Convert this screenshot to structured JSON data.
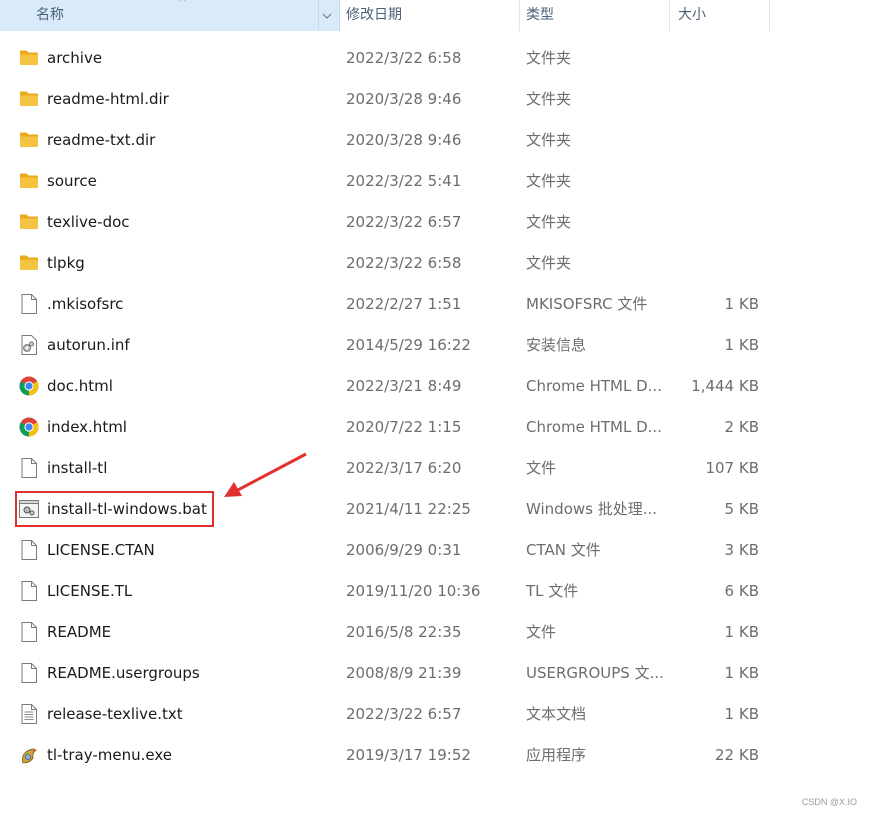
{
  "columns": {
    "name": "名称",
    "date": "修改日期",
    "type": "类型",
    "size": "大小"
  },
  "files": [
    {
      "name": "archive",
      "date": "2022/3/22 6:58",
      "type": "文件夹",
      "size": "",
      "icon": "folder-icon"
    },
    {
      "name": "readme-html.dir",
      "date": "2020/3/28 9:46",
      "type": "文件夹",
      "size": "",
      "icon": "folder-icon"
    },
    {
      "name": "readme-txt.dir",
      "date": "2020/3/28 9:46",
      "type": "文件夹",
      "size": "",
      "icon": "folder-icon"
    },
    {
      "name": "source",
      "date": "2022/3/22 5:41",
      "type": "文件夹",
      "size": "",
      "icon": "folder-icon"
    },
    {
      "name": "texlive-doc",
      "date": "2022/3/22 6:57",
      "type": "文件夹",
      "size": "",
      "icon": "folder-icon"
    },
    {
      "name": "tlpkg",
      "date": "2022/3/22 6:58",
      "type": "文件夹",
      "size": "",
      "icon": "folder-icon"
    },
    {
      "name": ".mkisofsrc",
      "date": "2022/2/27 1:51",
      "type": "MKISOFSRC 文件",
      "size": "1 KB",
      "icon": "blank-file-icon"
    },
    {
      "name": "autorun.inf",
      "date": "2014/5/29 16:22",
      "type": "安装信息",
      "size": "1 KB",
      "icon": "settings-file-icon"
    },
    {
      "name": "doc.html",
      "date": "2022/3/21 8:49",
      "type": "Chrome HTML D...",
      "size": "1,444 KB",
      "icon": "chrome-icon"
    },
    {
      "name": "index.html",
      "date": "2020/7/22 1:15",
      "type": "Chrome HTML D...",
      "size": "2 KB",
      "icon": "chrome-icon"
    },
    {
      "name": "install-tl",
      "date": "2022/3/17 6:20",
      "type": "文件",
      "size": "107 KB",
      "icon": "blank-file-icon"
    },
    {
      "name": "install-tl-windows.bat",
      "date": "2021/4/11 22:25",
      "type": "Windows 批处理...",
      "size": "5 KB",
      "icon": "batch-file-icon"
    },
    {
      "name": "LICENSE.CTAN",
      "date": "2006/9/29 0:31",
      "type": "CTAN 文件",
      "size": "3 KB",
      "icon": "blank-file-icon"
    },
    {
      "name": "LICENSE.TL",
      "date": "2019/11/20 10:36",
      "type": "TL 文件",
      "size": "6 KB",
      "icon": "blank-file-icon"
    },
    {
      "name": "README",
      "date": "2016/5/8 22:35",
      "type": "文件",
      "size": "1 KB",
      "icon": "blank-file-icon"
    },
    {
      "name": "README.usergroups",
      "date": "2008/8/9 21:39",
      "type": "USERGROUPS 文...",
      "size": "1 KB",
      "icon": "blank-file-icon"
    },
    {
      "name": "release-texlive.txt",
      "date": "2022/3/22 6:57",
      "type": "文本文档",
      "size": "1 KB",
      "icon": "text-file-icon"
    },
    {
      "name": "tl-tray-menu.exe",
      "date": "2019/3/17 19:52",
      "type": "应用程序",
      "size": "22 KB",
      "icon": "exe-icon"
    }
  ],
  "watermark": "CSDN @X.IO",
  "colors": {
    "header_active_bg": "#d9ebf9",
    "highlight_red": "#e03131",
    "folder_yellow": "#f5c342"
  }
}
